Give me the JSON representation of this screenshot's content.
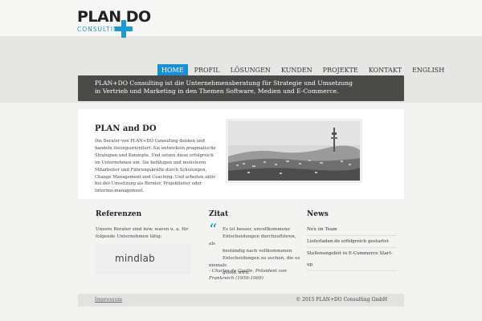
{
  "logo": {
    "main": "PLAN DO",
    "sub": "CONSULTING"
  },
  "nav": [
    "HOME",
    "PROFIL",
    "LÖSUNGEN",
    "KUNDEN",
    "PROJEKTE",
    "KONTAKT",
    "ENGLISH"
  ],
  "nav_active": "HOME",
  "tagline": {
    "line1": "PLAN+DO Consulting ist die Unternehmensberatung für Strategie und Umsetzung",
    "line2": "in Vertrieb und Marketing in den Themen Software, Medien und E-Commerce."
  },
  "intro": {
    "title": "PLAN and DO",
    "lines": [
      "Die Berater von PLAN+DO Consulting denken und",
      "handeln lösungsorientiert. Sie entwickeln pragmatische",
      "Strategien und Konzepte. Und setzen diese erfolgreich",
      "im Unternehmen um. Sie befähigen und motivieren",
      "Mitarbeiter und Führungskräfte durch Schulungen,",
      "Change Management und Coaching. Und arbeiten aktiv",
      "bei der Umsetzung als Berater, Projektleiter oder",
      "Interims-management."
    ]
  },
  "references": {
    "title": "Referenzen",
    "line1": "Unsere Berater sind bzw. waren u. a. für",
    "line2": "folgende Unternehmen tätig:",
    "logo_text": "mindlab"
  },
  "quote": {
    "title": "Zitat",
    "mark": "“",
    "lines": [
      "Es ist besser, unvollkommene",
      "Entscheidungen durchzuführen, als",
      "beständig nach vollkommenen",
      "Entscheidungen zu suchen, die es niemals",
      "geben wird."
    ],
    "author_line1": "- Charles de Gaulle, Präsident von",
    "author_line2": "Frankreich (1959-1969)"
  },
  "news": {
    "title": "News",
    "items": [
      "Neu im Team",
      "Lieferladen.de erfolgreich gestartet",
      "Stellenangebot in E-Commerce Start-up"
    ]
  },
  "footer": {
    "impressum": "Impressum",
    "copyright": "© 2015 PLAN+DO Consulting GmbH"
  },
  "colors": {
    "accent": "#1d8fd0",
    "tagline_bg": "#4a4a48"
  },
  "icons": {
    "logo_plus": "plus-icon",
    "photo": "city-skyline-photo"
  }
}
